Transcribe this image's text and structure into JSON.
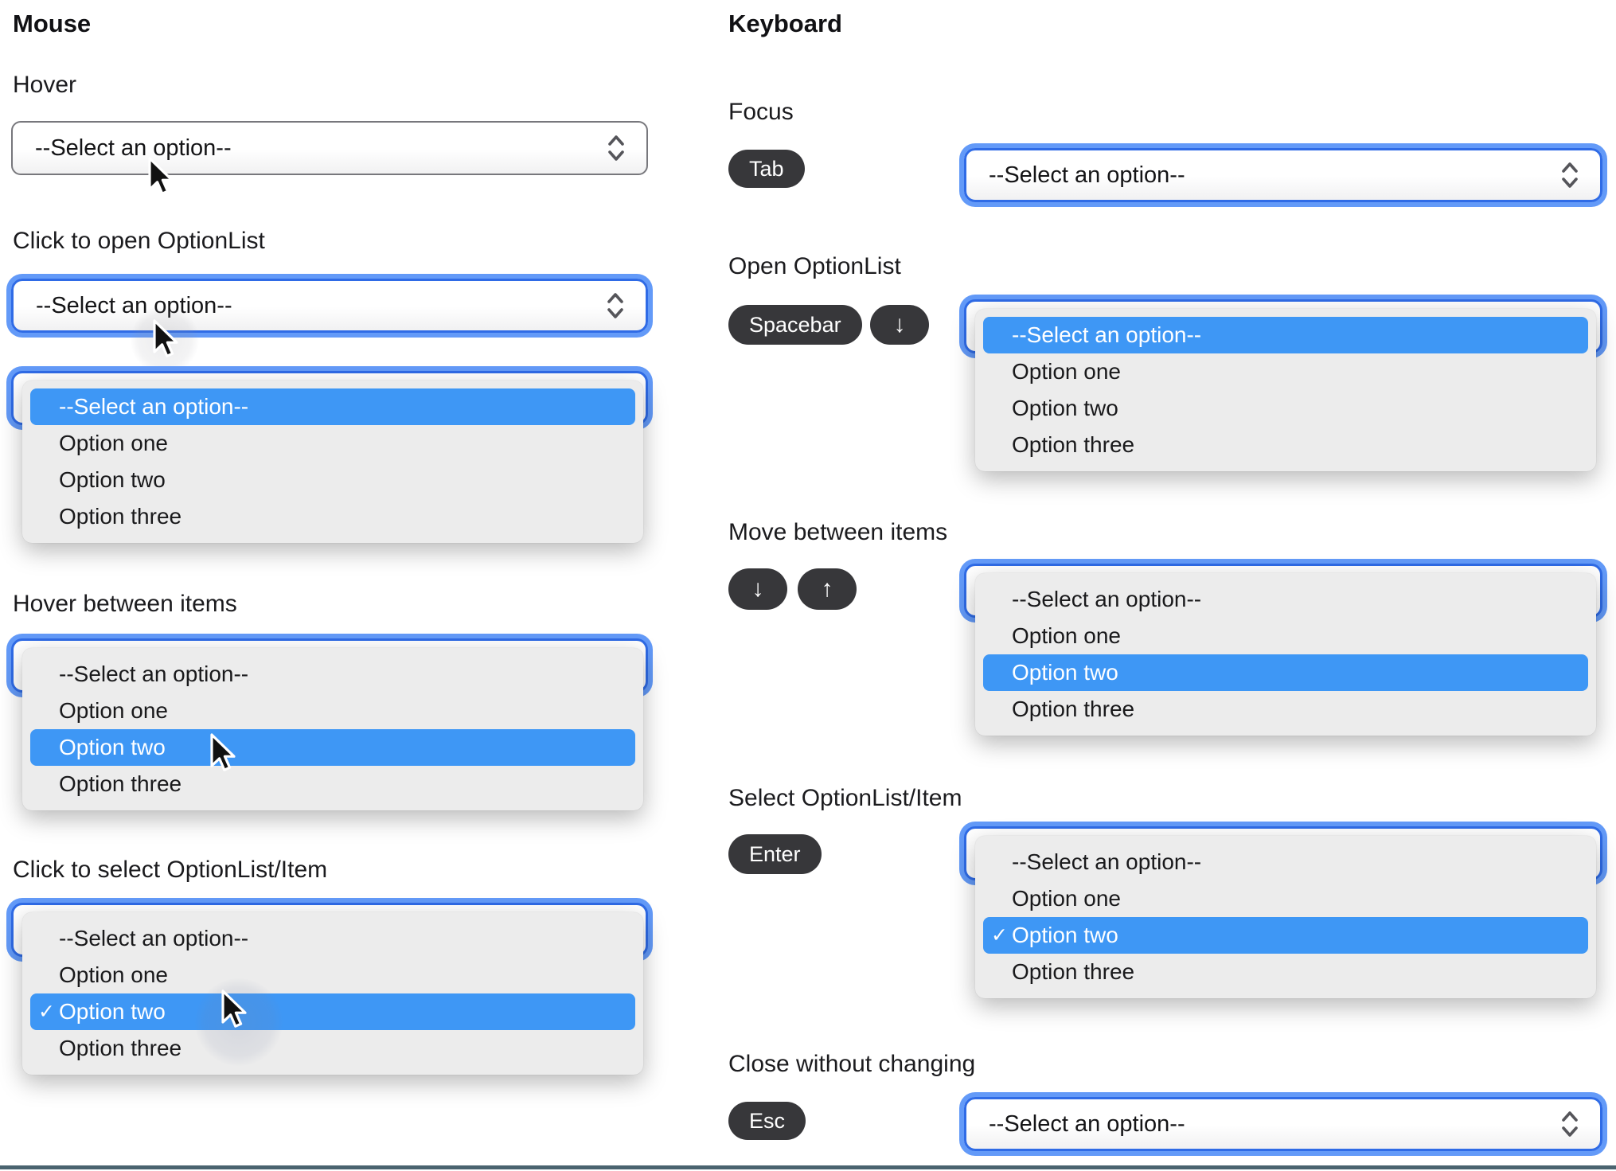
{
  "placeholder": "--Select an option--",
  "options": [
    "--Select an option--",
    "Option one",
    "Option two",
    "Option three"
  ],
  "icons": {
    "check": "✓",
    "arrow_down": "↓",
    "arrow_up": "↑",
    "stepper": "up-down chevrons"
  },
  "colors": {
    "highlight_blue": "#3e97f5",
    "focus_ring_outer": "#639af8",
    "focus_ring_border": "#2f6be6",
    "select_border": "#77777c",
    "panel_bg": "#ececec",
    "key_pill_bg": "#37373a",
    "divider": "#4a636f"
  },
  "mouse": {
    "title": "Mouse",
    "hover_label": "Hover",
    "click_open_label": "Click to open OptionList",
    "hover_items_label": "Hover between items",
    "click_select_label": "Click to select OptionList/Item"
  },
  "keyboard": {
    "title": "Keyboard",
    "focus_label": "Focus",
    "open_label": "Open OptionList",
    "move_label": "Move between items",
    "select_label": "Select OptionList/Item",
    "close_label": "Close without changing",
    "keys": {
      "tab": "Tab",
      "spacebar": "Spacebar",
      "enter": "Enter",
      "esc": "Esc"
    }
  }
}
